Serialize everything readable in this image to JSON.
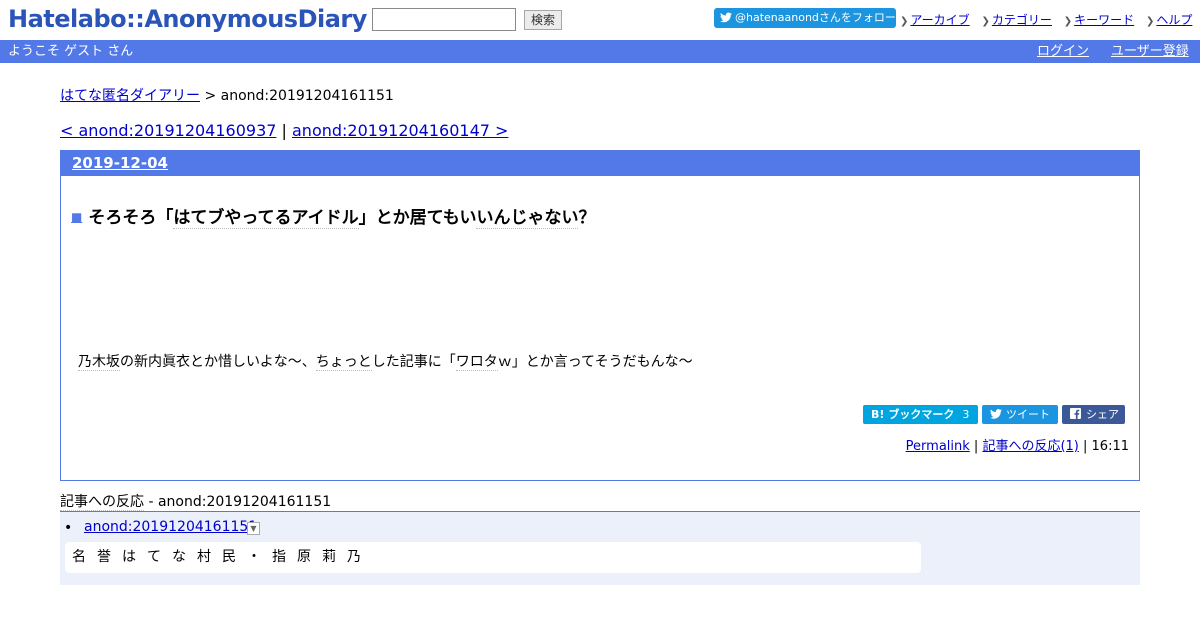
{
  "header": {
    "logo": "Hatelabo::AnonymousDiary",
    "search_button": "検索",
    "follow_button": "@hatenaanondさんをフォロー",
    "nav_links": [
      "アーカイブ",
      "カテゴリー",
      "キーワード",
      "ヘルプ"
    ]
  },
  "user_bar": {
    "welcome": "ようこそ ゲスト さん",
    "login": "ログイン",
    "register": "ユーザー登録"
  },
  "breadcrumb": {
    "home": "はてな匿名ダイアリー",
    "separator": " > ",
    "current": "anond:20191204161151"
  },
  "pager": {
    "prev": "< anond:20191204160937",
    "sep": " | ",
    "next": "anond:20191204160147 >"
  },
  "day": {
    "date": "2019-12-04",
    "entry": {
      "title_marker": "■",
      "title_before": "そろそろ「",
      "title_kw": "はてブやってるアイドル",
      "title_mid": "」とか居てもい",
      "title_kw2": "いんじゃない",
      "title_after": "？",
      "body_kw": "乃木坂",
      "body_mid": "の新内眞衣とか惜しいよな～、",
      "body_kw2": "ちょっと",
      "body_mid2": "した記事に「",
      "body_kw3": "ワロタ",
      "body_after": "ｗ」とか言ってそうだもんな～"
    },
    "share": {
      "hatebu_glyph": "B!",
      "hatebu_label": "ブックマーク",
      "hatebu_count": "3",
      "tweet": "ツイート",
      "fb_share": "シェア"
    },
    "footer": {
      "permalink": "Permalink",
      "sep1": " | ",
      "reactions": "記事への反応(1)",
      "sep2": " | ",
      "time": "16:11"
    }
  },
  "references": {
    "title_kw": "記事への反応",
    "title_rest": " - anond:20191204161151",
    "items": [
      {
        "link": "anond:20191204161151",
        "text": "名誉はてな村民・指原莉乃"
      }
    ]
  }
}
